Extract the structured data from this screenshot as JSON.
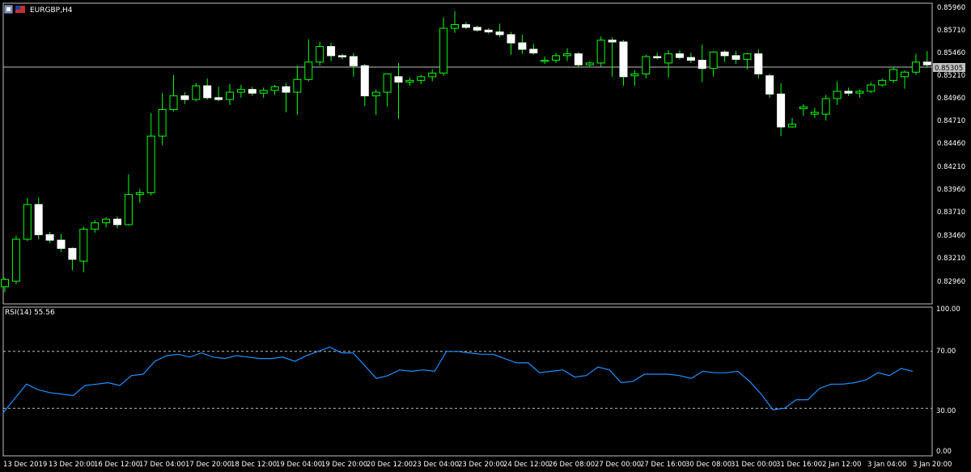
{
  "window": {
    "symbol_label": "EURGBP,H4",
    "icon_left": "chart-window-icon",
    "icon_right": "flag-icon"
  },
  "colors": {
    "background": "#000000",
    "frame": "#c0c0c0",
    "bull_outline": "#00ff00",
    "bull_fill": "#000000",
    "bear_fill": "#ffffff",
    "wick": "#00ff00",
    "rsi_line": "#1e90ff",
    "level_line": "#c0c0c0",
    "bid_line": "#c0c0c0",
    "price_tag_bg": "#c0c0c0",
    "price_tag_text": "#000000",
    "text": "#ffffff"
  },
  "price_axis": {
    "labels": [
      "0.85960",
      "0.85710",
      "0.85460",
      "0.85210",
      "0.84960",
      "0.84710",
      "0.84460",
      "0.84210",
      "0.83960",
      "0.83710",
      "0.83460",
      "0.83210",
      "0.82960"
    ],
    "current_price": "0.85305"
  },
  "rsi_panel": {
    "label": "RSI(14) 55.56",
    "axis_labels": [
      "100.00",
      "70.00",
      "30.00",
      "0.00"
    ]
  },
  "time_axis": {
    "labels": [
      "13 Dec 2019",
      "13 Dec 20:00",
      "16 Dec 12:00",
      "17 Dec 04:00",
      "17 Dec 20:00",
      "18 Dec 12:00",
      "19 Dec 04:00",
      "19 Dec 20:00",
      "20 Dec 12:00",
      "23 Dec 04:00",
      "23 Dec 20:00",
      "24 Dec 12:00",
      "26 Dec 08:00",
      "27 Dec 00:00",
      "27 Dec 16:00",
      "30 Dec 08:00",
      "31 Dec 00:00",
      "31 Dec 16:00",
      "2 Jan 12:00",
      "3 Jan 04:00",
      "3 Jan 20:00"
    ]
  },
  "chart_data": [
    {
      "type": "candlestick",
      "symbol": "EURGBP",
      "timeframe": "H4",
      "ylim": [
        0.8276,
        0.86
      ],
      "candles": [
        {
          "o": 0.829,
          "h": 0.83,
          "l": 0.8284,
          "c": 0.8298
        },
        {
          "o": 0.8296,
          "h": 0.8346,
          "l": 0.8293,
          "c": 0.8342
        },
        {
          "o": 0.8342,
          "h": 0.8387,
          "l": 0.834,
          "c": 0.838
        },
        {
          "o": 0.838,
          "h": 0.8388,
          "l": 0.8342,
          "c": 0.8347
        },
        {
          "o": 0.8347,
          "h": 0.835,
          "l": 0.8338,
          "c": 0.8341
        },
        {
          "o": 0.8341,
          "h": 0.8348,
          "l": 0.8328,
          "c": 0.8332
        },
        {
          "o": 0.8332,
          "h": 0.8333,
          "l": 0.8308,
          "c": 0.832
        },
        {
          "o": 0.8318,
          "h": 0.8356,
          "l": 0.8306,
          "c": 0.8353
        },
        {
          "o": 0.8353,
          "h": 0.8363,
          "l": 0.8349,
          "c": 0.836
        },
        {
          "o": 0.836,
          "h": 0.8366,
          "l": 0.8355,
          "c": 0.8364
        },
        {
          "o": 0.8364,
          "h": 0.8367,
          "l": 0.8354,
          "c": 0.8358
        },
        {
          "o": 0.8358,
          "h": 0.8413,
          "l": 0.8357,
          "c": 0.8391
        },
        {
          "o": 0.8391,
          "h": 0.8397,
          "l": 0.8382,
          "c": 0.8393
        },
        {
          "o": 0.8393,
          "h": 0.848,
          "l": 0.839,
          "c": 0.8455
        },
        {
          "o": 0.8455,
          "h": 0.8502,
          "l": 0.8445,
          "c": 0.8484
        },
        {
          "o": 0.8484,
          "h": 0.8522,
          "l": 0.8482,
          "c": 0.8499
        },
        {
          "o": 0.8499,
          "h": 0.8503,
          "l": 0.849,
          "c": 0.8495
        },
        {
          "o": 0.8495,
          "h": 0.8513,
          "l": 0.8493,
          "c": 0.851
        },
        {
          "o": 0.851,
          "h": 0.8518,
          "l": 0.8495,
          "c": 0.8497
        },
        {
          "o": 0.8497,
          "h": 0.8509,
          "l": 0.8493,
          "c": 0.8495
        },
        {
          "o": 0.8495,
          "h": 0.8512,
          "l": 0.8489,
          "c": 0.8503
        },
        {
          "o": 0.8503,
          "h": 0.8511,
          "l": 0.8497,
          "c": 0.8506
        },
        {
          "o": 0.8506,
          "h": 0.8509,
          "l": 0.8499,
          "c": 0.8502
        },
        {
          "o": 0.8502,
          "h": 0.8508,
          "l": 0.8497,
          "c": 0.8505
        },
        {
          "o": 0.8505,
          "h": 0.8511,
          "l": 0.85,
          "c": 0.8509
        },
        {
          "o": 0.8509,
          "h": 0.8513,
          "l": 0.8481,
          "c": 0.8503
        },
        {
          "o": 0.8503,
          "h": 0.8532,
          "l": 0.8478,
          "c": 0.8517
        },
        {
          "o": 0.8517,
          "h": 0.8561,
          "l": 0.8515,
          "c": 0.8536
        },
        {
          "o": 0.8536,
          "h": 0.8558,
          "l": 0.8532,
          "c": 0.8553
        },
        {
          "o": 0.8553,
          "h": 0.8557,
          "l": 0.8537,
          "c": 0.8543
        },
        {
          "o": 0.8543,
          "h": 0.8545,
          "l": 0.8539,
          "c": 0.8542
        },
        {
          "o": 0.8542,
          "h": 0.8546,
          "l": 0.852,
          "c": 0.8532
        },
        {
          "o": 0.8532,
          "h": 0.8534,
          "l": 0.8488,
          "c": 0.8499
        },
        {
          "o": 0.8499,
          "h": 0.8506,
          "l": 0.8478,
          "c": 0.8503
        },
        {
          "o": 0.8503,
          "h": 0.8514,
          "l": 0.8487,
          "c": 0.8523
        },
        {
          "o": 0.852,
          "h": 0.8535,
          "l": 0.8474,
          "c": 0.8514
        },
        {
          "o": 0.8514,
          "h": 0.8519,
          "l": 0.851,
          "c": 0.8516
        },
        {
          "o": 0.8516,
          "h": 0.8522,
          "l": 0.8512,
          "c": 0.852
        },
        {
          "o": 0.852,
          "h": 0.8528,
          "l": 0.8515,
          "c": 0.8524
        },
        {
          "o": 0.8524,
          "h": 0.8585,
          "l": 0.8521,
          "c": 0.8573
        },
        {
          "o": 0.8573,
          "h": 0.8592,
          "l": 0.8568,
          "c": 0.8577
        },
        {
          "o": 0.8577,
          "h": 0.858,
          "l": 0.8572,
          "c": 0.8574
        },
        {
          "o": 0.8574,
          "h": 0.8576,
          "l": 0.8569,
          "c": 0.8571
        },
        {
          "o": 0.8571,
          "h": 0.8573,
          "l": 0.8567,
          "c": 0.8569
        },
        {
          "o": 0.8569,
          "h": 0.8578,
          "l": 0.8563,
          "c": 0.8566
        },
        {
          "o": 0.8566,
          "h": 0.8569,
          "l": 0.8544,
          "c": 0.8557
        },
        {
          "o": 0.8557,
          "h": 0.8566,
          "l": 0.8545,
          "c": 0.855
        },
        {
          "o": 0.855,
          "h": 0.8556,
          "l": 0.8544,
          "c": 0.8546
        },
        {
          "o": 0.8537,
          "h": 0.8542,
          "l": 0.8534,
          "c": 0.8538
        },
        {
          "o": 0.8538,
          "h": 0.8546,
          "l": 0.8535,
          "c": 0.8543
        },
        {
          "o": 0.8543,
          "h": 0.8551,
          "l": 0.8537,
          "c": 0.8545
        },
        {
          "o": 0.8545,
          "h": 0.8547,
          "l": 0.853,
          "c": 0.8533
        },
        {
          "o": 0.8533,
          "h": 0.8537,
          "l": 0.853,
          "c": 0.8535
        },
        {
          "o": 0.8535,
          "h": 0.8564,
          "l": 0.8531,
          "c": 0.856
        },
        {
          "o": 0.856,
          "h": 0.8563,
          "l": 0.852,
          "c": 0.8558
        },
        {
          "o": 0.8558,
          "h": 0.856,
          "l": 0.851,
          "c": 0.852
        },
        {
          "o": 0.8521,
          "h": 0.8527,
          "l": 0.851,
          "c": 0.8523
        },
        {
          "o": 0.8523,
          "h": 0.8544,
          "l": 0.8518,
          "c": 0.8542
        },
        {
          "o": 0.8542,
          "h": 0.8546,
          "l": 0.8539,
          "c": 0.8541
        },
        {
          "o": 0.8535,
          "h": 0.8549,
          "l": 0.8519,
          "c": 0.8545
        },
        {
          "o": 0.8545,
          "h": 0.8549,
          "l": 0.8539,
          "c": 0.8541
        },
        {
          "o": 0.8541,
          "h": 0.8546,
          "l": 0.8535,
          "c": 0.8538
        },
        {
          "o": 0.8538,
          "h": 0.8555,
          "l": 0.8514,
          "c": 0.8529
        },
        {
          "o": 0.8529,
          "h": 0.8548,
          "l": 0.852,
          "c": 0.8547
        },
        {
          "o": 0.8547,
          "h": 0.8549,
          "l": 0.8536,
          "c": 0.8543
        },
        {
          "o": 0.8543,
          "h": 0.8548,
          "l": 0.8534,
          "c": 0.8539
        },
        {
          "o": 0.8539,
          "h": 0.8546,
          "l": 0.8528,
          "c": 0.8545
        },
        {
          "o": 0.8545,
          "h": 0.855,
          "l": 0.8518,
          "c": 0.8523
        },
        {
          "o": 0.8521,
          "h": 0.8523,
          "l": 0.8497,
          "c": 0.8501
        },
        {
          "o": 0.8501,
          "h": 0.8513,
          "l": 0.8455,
          "c": 0.8465
        },
        {
          "o": 0.8465,
          "h": 0.8475,
          "l": 0.8464,
          "c": 0.8468
        },
        {
          "o": 0.8485,
          "h": 0.849,
          "l": 0.8477,
          "c": 0.8487
        },
        {
          "o": 0.8479,
          "h": 0.8486,
          "l": 0.8475,
          "c": 0.8481
        },
        {
          "o": 0.8479,
          "h": 0.85,
          "l": 0.8472,
          "c": 0.8496
        },
        {
          "o": 0.8496,
          "h": 0.8515,
          "l": 0.8489,
          "c": 0.8504
        },
        {
          "o": 0.8504,
          "h": 0.8508,
          "l": 0.8499,
          "c": 0.8502
        },
        {
          "o": 0.8502,
          "h": 0.8506,
          "l": 0.8497,
          "c": 0.8504
        },
        {
          "o": 0.8504,
          "h": 0.8514,
          "l": 0.8502,
          "c": 0.8511
        },
        {
          "o": 0.8511,
          "h": 0.8518,
          "l": 0.8509,
          "c": 0.8516
        },
        {
          "o": 0.8516,
          "h": 0.8531,
          "l": 0.8513,
          "c": 0.8528
        },
        {
          "o": 0.852,
          "h": 0.8527,
          "l": 0.8507,
          "c": 0.8525
        },
        {
          "o": 0.8525,
          "h": 0.8545,
          "l": 0.8522,
          "c": 0.8536
        },
        {
          "o": 0.8536,
          "h": 0.8548,
          "l": 0.853,
          "c": 0.8533
        }
      ]
    },
    {
      "type": "line",
      "name": "RSI(14)",
      "ylim": [
        0,
        100
      ],
      "levels": [
        70,
        30
      ],
      "values": [
        27,
        37,
        47,
        43,
        41,
        40,
        39,
        46,
        47,
        48,
        46,
        53,
        54,
        63,
        67,
        68,
        66,
        69,
        66,
        65,
        67,
        66,
        65,
        65,
        66,
        63,
        67,
        70,
        73,
        69,
        69,
        60,
        51,
        53,
        57,
        56,
        57,
        56,
        70,
        70,
        69,
        68,
        68,
        65,
        62,
        62,
        55,
        56,
        57,
        52,
        53,
        59,
        57,
        48,
        49,
        54,
        54,
        54,
        53,
        51,
        56,
        55,
        55,
        56,
        49,
        40,
        29,
        30,
        36,
        36,
        44,
        47,
        47,
        48,
        50,
        55,
        53,
        58,
        56
      ]
    }
  ]
}
